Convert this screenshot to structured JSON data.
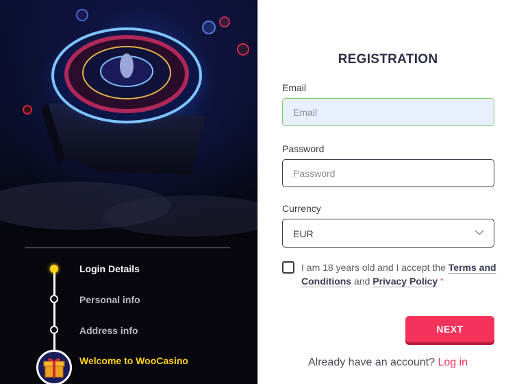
{
  "steps": [
    {
      "label": "Login Details",
      "state": "active"
    },
    {
      "label": "Personal info",
      "state": "pending"
    },
    {
      "label": "Address info",
      "state": "pending"
    },
    {
      "label": "Welcome to WooCasino",
      "state": "final"
    }
  ],
  "form": {
    "title": "REGISTRATION",
    "email": {
      "label": "Email",
      "placeholder": "Email",
      "value": ""
    },
    "password": {
      "label": "Password",
      "placeholder": "Password",
      "value": ""
    },
    "currency": {
      "label": "Currency",
      "selected": "EUR"
    },
    "consent": {
      "text_before": "I am 18 years old and I accept the ",
      "terms_link": "Terms and Conditions",
      "text_middle": " and ",
      "privacy_link": "Privacy Policy",
      "required_mark": "*",
      "checked": false
    },
    "next_label": "NEXT",
    "footer_text": "Already have an account? ",
    "login_link": "Log in"
  },
  "colors": {
    "accent": "#f5335a",
    "active_step": "#ffd21a",
    "focused_input_border": "#7bc86c",
    "focused_input_bg": "#e8f0fe",
    "dark_panel": "#07070d"
  },
  "icons": {
    "roulette": "roulette-wheel-illustration",
    "gift": "gift-icon",
    "chevron": "chevron-down-icon"
  }
}
